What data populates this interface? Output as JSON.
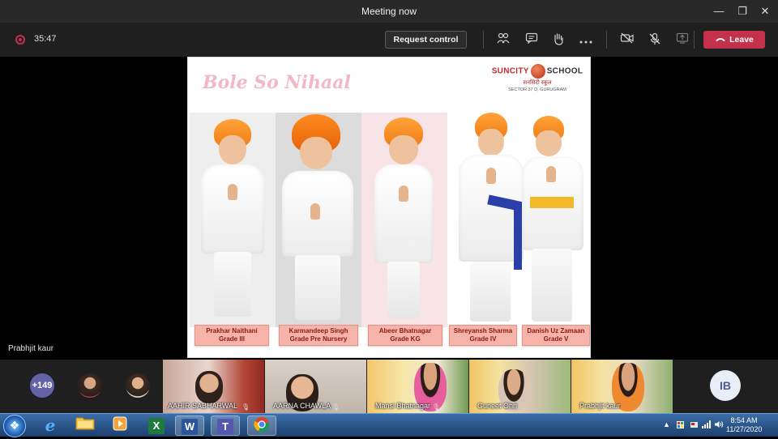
{
  "window": {
    "title": "Meeting now",
    "minimize_glyph": "—",
    "restore_glyph": "❐",
    "close_glyph": "✕"
  },
  "toolbar": {
    "timer": "35:47",
    "request_control_label": "Request control",
    "leave_label": "Leave",
    "icons": [
      "participants-icon",
      "chat-icon",
      "raise-hand-icon",
      "more-options-icon",
      "camera-off-icon",
      "mic-off-icon",
      "share-screen-icon",
      "hang-up-icon"
    ]
  },
  "slide": {
    "heading": "Bole So Nihaal",
    "logo": {
      "brand_left": "SUNCITY",
      "brand_right": "SCHOOL",
      "hindi": "सनसिटी स्कूल",
      "sector": "SECTOR 37 D, GURUGRAM"
    },
    "students": [
      {
        "name": "Prakhar Naithani",
        "grade": "Grade III"
      },
      {
        "name": "Karmandeep Singh",
        "grade": "Grade Pre Nursery"
      },
      {
        "name": "Abeer Bhatnagar",
        "grade": "Grade KG"
      },
      {
        "name": "Shreyansh Sharma",
        "grade": "Grade IV"
      },
      {
        "name": "Danish Uz Zamaan",
        "grade": "Grade V"
      }
    ]
  },
  "active_speaker": "Prabhjit kaur",
  "participants": {
    "overflow_count": "+149",
    "tiles": [
      {
        "name": "AAHIR SABHARWAL"
      },
      {
        "name": "AARNA CHAWLA"
      },
      {
        "name": "Mansi Bhatnagar"
      },
      {
        "name": "Guneet Ohri"
      },
      {
        "name": "Prabhjit kaur"
      }
    ],
    "self_initials": "IB"
  },
  "taskbar": {
    "apps": [
      "internet-explorer-icon",
      "file-explorer-icon",
      "media-player-icon",
      "excel-icon",
      "word-icon",
      "teams-icon",
      "chrome-icon"
    ],
    "excel_glyph": "X",
    "word_glyph": "W",
    "teams_glyph": "T",
    "ie_glyph": "e",
    "clock_time": "8:54 AM",
    "clock_date": "11/27/2020"
  },
  "colors": {
    "leave": "#c4314b",
    "badge": "#6264a7",
    "turban": "#f58a1f",
    "name_card": "#f6b3a9"
  }
}
